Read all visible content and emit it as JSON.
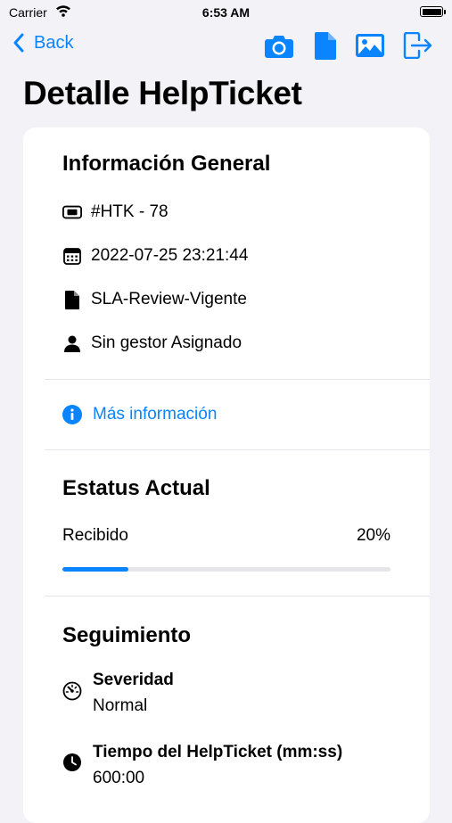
{
  "status_bar": {
    "carrier": "Carrier",
    "time": "6:53 AM"
  },
  "nav": {
    "back_label": "Back",
    "actions": [
      "camera-icon",
      "document-icon",
      "photo-icon",
      "logout-icon"
    ],
    "accent_color": "#0a84ff"
  },
  "page": {
    "title": "Detalle HelpTicket"
  },
  "general": {
    "title": "Información General",
    "ticket_id": "#HTK - 78",
    "date": "2022-07-25 23:21:44",
    "sla": "SLA-Review-Vigente",
    "manager": "Sin gestor Asignado",
    "more_info": "Más información"
  },
  "status": {
    "title": "Estatus Actual",
    "label": "Recibido",
    "percent_text": "20%",
    "progress": 0.2
  },
  "tracking": {
    "title": "Seguimiento",
    "items": [
      {
        "label": "Severidad",
        "value": "Normal",
        "icon": "speedometer-icon"
      },
      {
        "label": "Tiempo del HelpTicket (mm:ss)",
        "value": "600:00",
        "icon": "clock-icon"
      }
    ]
  }
}
